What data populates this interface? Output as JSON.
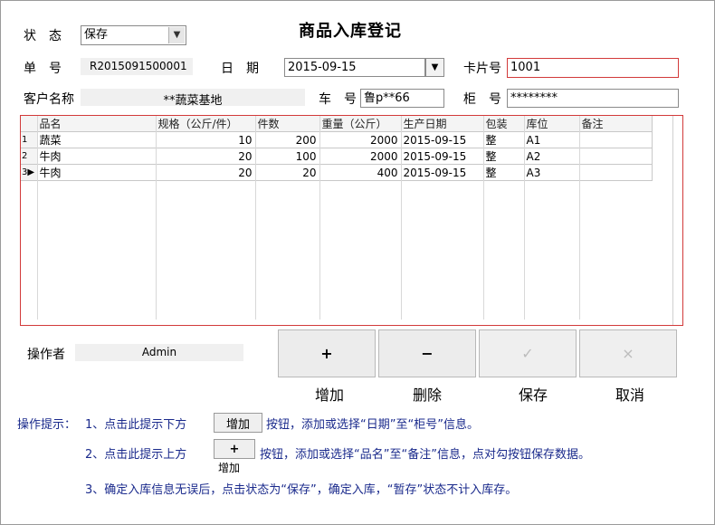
{
  "form": {
    "title": "商品入库登记",
    "status_label": "状　态",
    "status_value": "保存",
    "order_label": "单　号",
    "order_value": "R2015091500001",
    "date_label": "日　期",
    "date_value": "2015-09-15",
    "card_label": "卡片号",
    "card_value": "1001",
    "customer_label": "客户名称",
    "customer_value": "**蔬菜基地",
    "vehicle_label": "车　号",
    "vehicle_value": "鲁p**66",
    "cabinet_label": "柜　号",
    "cabinet_value": "********",
    "operator_label": "操作者",
    "operator_value": "Admin"
  },
  "grid": {
    "columns": [
      "品名",
      "规格（公斤/件）",
      "件数",
      "重量（公斤）",
      "生产日期",
      "包装",
      "库位",
      "备注"
    ],
    "rows": [
      {
        "no": "1",
        "name": "蔬菜",
        "spec": "10",
        "count": "200",
        "weight": "2000",
        "date": "2015-09-15",
        "pack": "整",
        "loc": "A1",
        "note": ""
      },
      {
        "no": "2",
        "name": "牛肉",
        "spec": "20",
        "count": "100",
        "weight": "2000",
        "date": "2015-09-15",
        "pack": "整",
        "loc": "A2",
        "note": ""
      },
      {
        "no": "3",
        "name": "牛肉",
        "spec": "20",
        "count": "20",
        "weight": "400",
        "date": "2015-09-15",
        "pack": "整",
        "loc": "A3",
        "note": ""
      }
    ]
  },
  "actions": {
    "add_symbol": "+",
    "add_label": "增加",
    "delete_symbol": "−",
    "delete_label": "删除",
    "save_symbol": "✓",
    "save_label": "保存",
    "cancel_symbol": "×",
    "cancel_label": "取消"
  },
  "hints": {
    "prefix": "操作提示：",
    "line1_a": "1、点击此提示下方",
    "line1_btn": "增加",
    "line1_b": "按钮，添加或选择“日期”至“柜号”信息。",
    "line2_a": "2、点击此提示上方",
    "line2_btn_symbol": "+",
    "line2_btn_caption": "增加",
    "line2_b": "按钮，添加或选择“品名”至“备注”信息，点对勾按钮保存数据。",
    "line3": "3、确定入库信息无误后，点击状态为“保存”，确定入库，“暂存”状态不计入库存。"
  }
}
